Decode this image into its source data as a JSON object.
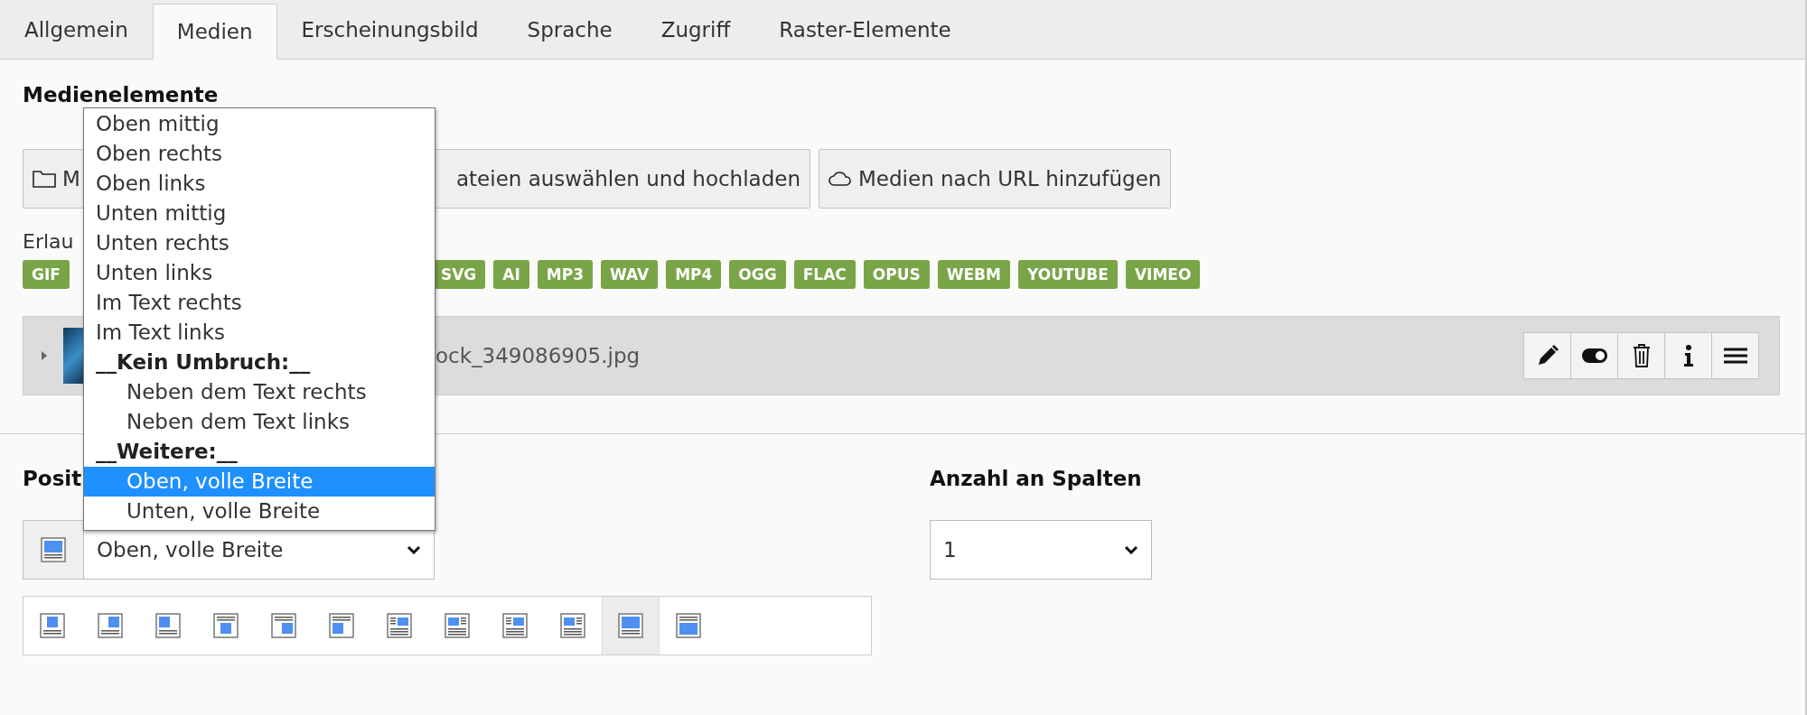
{
  "tabs": [
    {
      "label": "Allgemein",
      "selected": false
    },
    {
      "label": "Medien",
      "selected": true
    },
    {
      "label": "Erscheinungsbild",
      "selected": false
    },
    {
      "label": "Sprache",
      "selected": false
    },
    {
      "label": "Zugriff",
      "selected": false
    },
    {
      "label": "Raster-Elemente",
      "selected": false
    }
  ],
  "media": {
    "title": "Medienelemente",
    "buttons": [
      {
        "label": "M"
      },
      {
        "label": "ateien auswählen und hochladen"
      },
      {
        "label": "Medien nach URL hinzufügen"
      }
    ],
    "allowed_label": "Erlau",
    "tags": [
      "GIF",
      "SVG",
      "AI",
      "MP3",
      "WAV",
      "MP4",
      "OGG",
      "FLAC",
      "OPUS",
      "WEBM",
      "YOUTUBE",
      "VIMEO"
    ],
    "file": {
      "name": "ock_349086905.jpg",
      "expanded": false
    }
  },
  "position": {
    "label": "Posit",
    "value": "Oben, volle Breite",
    "options": [
      {
        "label": "Oben mittig",
        "selected": false
      },
      {
        "label": "Oben rechts",
        "selected": false
      },
      {
        "label": "Oben links",
        "selected": false
      },
      {
        "label": "Unten mittig",
        "selected": false
      },
      {
        "label": "Unten rechts",
        "selected": false
      },
      {
        "label": "Unten links",
        "selected": false
      },
      {
        "label": "Im Text rechts",
        "selected": false
      },
      {
        "label": "Im Text links",
        "selected": false
      },
      {
        "kind": "group",
        "label": "__Kein Umbruch:__",
        "children": [
          {
            "label": "Neben dem Text rechts",
            "selected": false
          },
          {
            "label": "Neben dem Text links",
            "selected": false
          }
        ]
      },
      {
        "kind": "group",
        "label": "__Weitere:__",
        "children": [
          {
            "label": "Oben, volle Breite",
            "selected": true
          },
          {
            "label": "Unten, volle Breite",
            "selected": false
          }
        ]
      }
    ],
    "layouts": [
      {
        "selected": false
      },
      {
        "selected": false
      },
      {
        "selected": false
      },
      {
        "selected": false
      },
      {
        "selected": false
      },
      {
        "selected": false
      },
      {
        "selected": false
      },
      {
        "selected": false
      },
      {
        "selected": false
      },
      {
        "selected": false
      },
      {
        "selected": true
      },
      {
        "selected": false
      }
    ]
  },
  "columns": {
    "label": "Anzahl an Spalten",
    "value": "1"
  }
}
